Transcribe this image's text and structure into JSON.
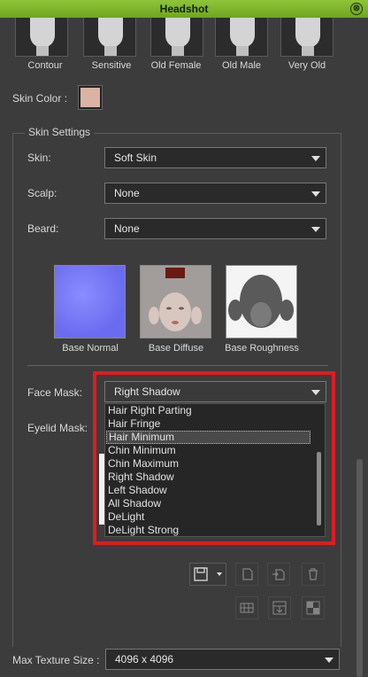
{
  "window": {
    "title": "Headshot",
    "close_symbol": "⊗"
  },
  "presets": [
    {
      "label": "Contour"
    },
    {
      "label": "Sensitive"
    },
    {
      "label": "Old Female"
    },
    {
      "label": "Old Male"
    },
    {
      "label": "Very Old"
    }
  ],
  "skin_color": {
    "label": "Skin Color :",
    "value": "#d9b3a3"
  },
  "skin_settings": {
    "title": "Skin Settings",
    "skin": {
      "label": "Skin:",
      "value": "Soft Skin"
    },
    "scalp": {
      "label": "Scalp:",
      "value": "None"
    },
    "beard": {
      "label": "Beard:",
      "value": "None"
    },
    "textures": [
      {
        "label": "Base Normal"
      },
      {
        "label": "Base Diffuse"
      },
      {
        "label": "Base Roughness"
      }
    ],
    "face_mask": {
      "label": "Face Mask:",
      "value": "Right Shadow",
      "options": [
        "Hair Right Parting",
        "Hair Fringe",
        "Hair Minimum",
        "Chin Minimum",
        "Chin Maximum",
        "Right Shadow",
        "Left Shadow",
        "All Shadow",
        "DeLight",
        "DeLight Strong"
      ],
      "highlighted": "Hair Minimum"
    },
    "eyelid_mask": {
      "label": "Eyelid Mask:"
    }
  },
  "max_texture_size": {
    "label": "Max Texture Size :",
    "value": "4096 x 4096"
  },
  "colors": {
    "accent": "#7ab52a",
    "highlight_border": "#e01b22"
  }
}
